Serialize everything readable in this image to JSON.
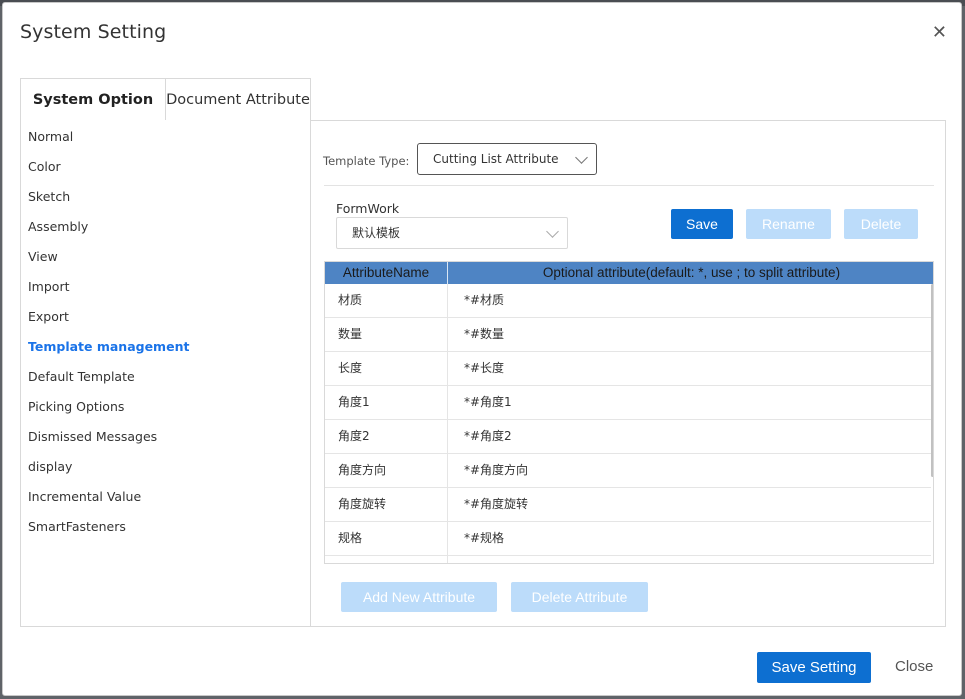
{
  "dialog": {
    "title": "System Setting",
    "close_icon": "close-icon"
  },
  "tabs": [
    {
      "label": "System Option",
      "active": true
    },
    {
      "label": "Document Attribute",
      "active": false
    }
  ],
  "nav": {
    "items": [
      {
        "label": "Normal"
      },
      {
        "label": "Color"
      },
      {
        "label": "Sketch"
      },
      {
        "label": "Assembly"
      },
      {
        "label": "View"
      },
      {
        "label": "Import"
      },
      {
        "label": "Export"
      },
      {
        "label": "Template management",
        "active": true
      },
      {
        "label": "Default Template"
      },
      {
        "label": "Picking Options"
      },
      {
        "label": "Dismissed Messages"
      },
      {
        "label": "display"
      },
      {
        "label": "Incremental Value"
      },
      {
        "label": "SmartFasteners"
      }
    ]
  },
  "template": {
    "type_label": "Template Type:",
    "type_value": "Cutting List Attribute",
    "formwork_label": "FormWork",
    "formwork_value": "默认模板"
  },
  "buttons": {
    "save": "Save",
    "rename": "Rename",
    "delete": "Delete",
    "add_attribute": "Add New Attribute",
    "delete_attribute": "Delete Attribute",
    "save_setting": "Save Setting",
    "close": "Close"
  },
  "table": {
    "headers": [
      "AttributeName",
      "Optional attribute(default: *, use ; to split attribute)"
    ],
    "rows": [
      {
        "name": "材质",
        "value": "*#材质"
      },
      {
        "name": "数量",
        "value": "*#数量"
      },
      {
        "name": "长度",
        "value": "*#长度"
      },
      {
        "name": "角度1",
        "value": "*#角度1"
      },
      {
        "name": "角度2",
        "value": "*#角度2"
      },
      {
        "name": "角度方向",
        "value": "*#角度方向"
      },
      {
        "name": "角度旋转",
        "value": "*#角度旋转"
      },
      {
        "name": "规格",
        "value": "*#规格"
      },
      {
        "name": "",
        "value": ""
      }
    ]
  },
  "colors": {
    "accent": "#0d6fd1",
    "disabled_button": "#bcdcfa",
    "table_header": "#4e84c4",
    "active_nav": "#1a73e8"
  }
}
